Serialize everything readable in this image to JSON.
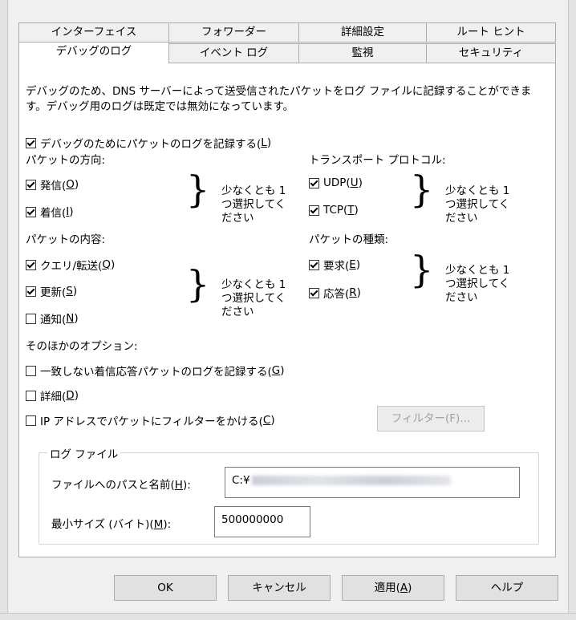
{
  "tabs_back": [
    {
      "label": "インターフェイス"
    },
    {
      "label": "フォワーダー"
    },
    {
      "label": "詳細設定"
    },
    {
      "label": "ルート ヒント"
    }
  ],
  "tabs_front": [
    {
      "label": "デバッグのログ"
    },
    {
      "label": "イベント ログ"
    },
    {
      "label": "監視"
    },
    {
      "label": "セキュリティ"
    }
  ],
  "description": "デバッグのため、DNS サーバーによって送受信されたパケットをログ ファイルに記録することができます。デバッグ用のログは既定では無効になっています。",
  "log_packets": {
    "pre": "デバッグのためにパケットのログを記録する(",
    "key": "L",
    "post": ")",
    "checked": true
  },
  "direction": {
    "title": "パケットの方向:",
    "outgoing": {
      "pre": "発信(",
      "key": "O",
      "post": ")",
      "checked": true
    },
    "incoming": {
      "pre": "着信(",
      "key": "I",
      "post": ")",
      "checked": true
    },
    "note": "少なくとも 1 つ選択してください"
  },
  "transport": {
    "title": "トランスポート プロトコル:",
    "udp": {
      "pre": "UDP(",
      "key": "U",
      "post": ")",
      "checked": true
    },
    "tcp": {
      "pre": "TCP(",
      "key": "T",
      "post": ")",
      "checked": true
    },
    "note": "少なくとも 1 つ選択してください"
  },
  "contents": {
    "title": "パケットの内容:",
    "query": {
      "pre": "クエリ/転送(",
      "key": "Q",
      "post": ")",
      "checked": true
    },
    "update": {
      "pre": "更新(",
      "key": "S",
      "post": ")",
      "checked": true
    },
    "notify": {
      "pre": "通知(",
      "key": "N",
      "post": ")",
      "checked": false
    },
    "note": "少なくとも 1 つ選択してください"
  },
  "packet_type": {
    "title": "パケットの種類:",
    "request": {
      "pre": "要求(",
      "key": "E",
      "post": ")",
      "checked": true
    },
    "response": {
      "pre": "応答(",
      "key": "R",
      "post": ")",
      "checked": true
    },
    "note": "少なくとも 1 つ選択してください"
  },
  "other": {
    "title": "そのほかのオプション:",
    "unmatched": {
      "pre": "一致しない着信応答パケットのログを記録する(",
      "key": "G",
      "post": ")",
      "checked": false
    },
    "details": {
      "pre": "詳細(",
      "key": "D",
      "post": ")",
      "checked": false
    },
    "ipfilter": {
      "pre": "IP アドレスでパケットにフィルターをかける(",
      "key": "C",
      "post": ")",
      "checked": false
    },
    "filter_button": "フィルター(F)..."
  },
  "log_file": {
    "title": "ログ ファイル",
    "path_label": {
      "pre": "ファイルへのパスと名前(",
      "key": "H",
      "post": "):"
    },
    "path_value": "C:¥",
    "size_label": {
      "pre": "最小サイズ (バイト)(",
      "key": "M",
      "post": "):"
    },
    "size_value": "500000000"
  },
  "buttons": {
    "ok": "OK",
    "cancel": "キャンセル",
    "apply": {
      "pre": "適用(",
      "key": "A",
      "post": ")"
    },
    "help": "ヘルプ"
  }
}
